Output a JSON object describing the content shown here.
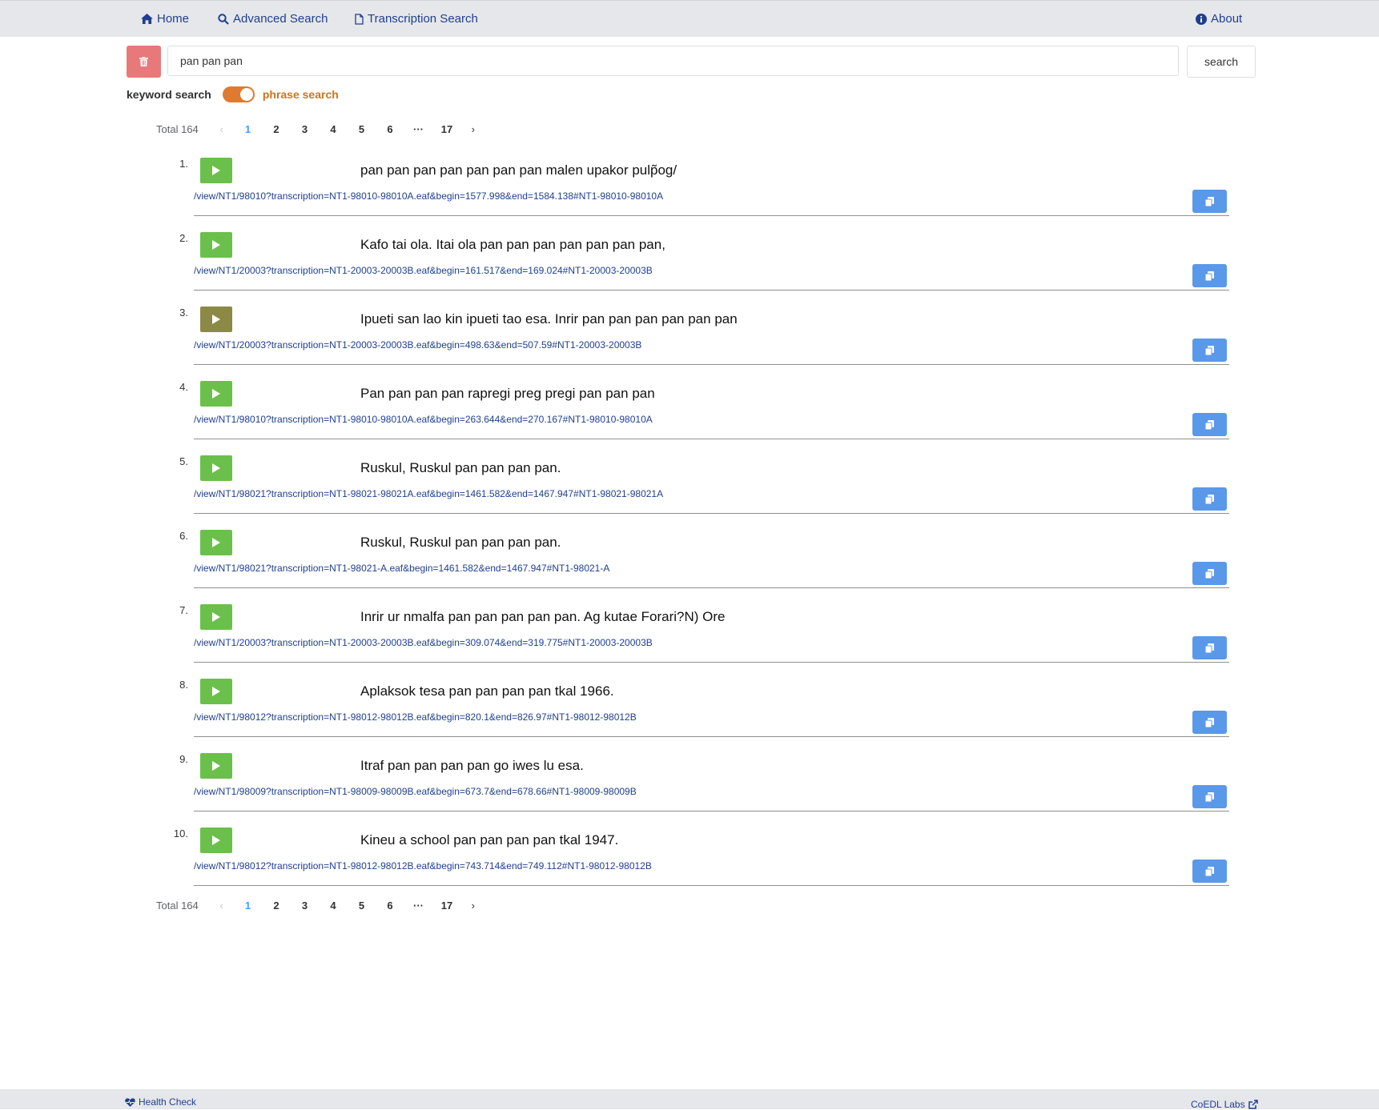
{
  "nav": {
    "home": "Home",
    "advanced_search": "Advanced Search",
    "transcription_search": "Transcription Search",
    "about": "About"
  },
  "search": {
    "value": "pan pan pan",
    "button_label": "search"
  },
  "mode": {
    "keyword_label": "keyword search",
    "phrase_label": "phrase search",
    "phrase_enabled": true
  },
  "pagination": {
    "total_label": "Total 164",
    "pages": [
      "1",
      "2",
      "3",
      "4",
      "5",
      "6",
      "···",
      "17"
    ],
    "active_page": "1"
  },
  "results": [
    {
      "index": "1.",
      "text": "pan pan pan pan pan pan pan malen upakor pulp̃og/",
      "link": "/view/NT1/98010?transcription=NT1-98010-98010A.eaf&begin=1577.998&end=1584.138#NT1-98010-98010A"
    },
    {
      "index": "2.",
      "text": "Kafo tai ola. Itai ola pan pan pan pan pan pan pan,",
      "link": "/view/NT1/20003?transcription=NT1-20003-20003B.eaf&begin=161.517&end=169.024#NT1-20003-20003B"
    },
    {
      "index": "3.",
      "text": "Ipueti san lao kin ipueti tao esa. Inrir pan pan pan pan pan pan",
      "link": "/view/NT1/20003?transcription=NT1-20003-20003B.eaf&begin=498.63&end=507.59#NT1-20003-20003B"
    },
    {
      "index": "4.",
      "text": "Pan pan pan pan rapregi preg pregi pan pan pan",
      "link": "/view/NT1/98010?transcription=NT1-98010-98010A.eaf&begin=263.644&end=270.167#NT1-98010-98010A"
    },
    {
      "index": "5.",
      "text": "Ruskul, Ruskul pan pan pan pan.",
      "link": "/view/NT1/98021?transcription=NT1-98021-98021A.eaf&begin=1461.582&end=1467.947#NT1-98021-98021A"
    },
    {
      "index": "6.",
      "text": "Ruskul, Ruskul pan pan pan pan.",
      "link": "/view/NT1/98021?transcription=NT1-98021-A.eaf&begin=1461.582&end=1467.947#NT1-98021-A"
    },
    {
      "index": "7.",
      "text": "Inrir ur nmalfa pan pan pan pan pan. Ag kutae Forari?N) Ore",
      "link": "/view/NT1/20003?transcription=NT1-20003-20003B.eaf&begin=309.074&end=319.775#NT1-20003-20003B"
    },
    {
      "index": "8.",
      "text": "Aplaksok tesa pan pan pan pan tkal 1966.",
      "link": "/view/NT1/98012?transcription=NT1-98012-98012B.eaf&begin=820.1&end=826.97#NT1-98012-98012B"
    },
    {
      "index": "9.",
      "text": "Itraf pan pan pan pan go iwes lu esa.",
      "link": "/view/NT1/98009?transcription=NT1-98009-98009B.eaf&begin=673.7&end=678.66#NT1-98009-98009B"
    },
    {
      "index": "10.",
      "text": "Kineu a school pan pan pan pan tkal 1947.",
      "link": "/view/NT1/98012?transcription=NT1-98012-98012B.eaf&begin=743.714&end=749.112#NT1-98012-98012B"
    }
  ],
  "footer": {
    "health_check": "Health Check",
    "labs": "CoEDL Labs"
  },
  "colors": {
    "nav_bg": "#e6e7ea",
    "link": "#1f3f8f",
    "trash": "#e8797a",
    "toggle": "#e07a2f",
    "play": "#6bc04b",
    "play_alt": "#8a8a46",
    "copy": "#5a98ea",
    "active_page": "#409eff"
  }
}
